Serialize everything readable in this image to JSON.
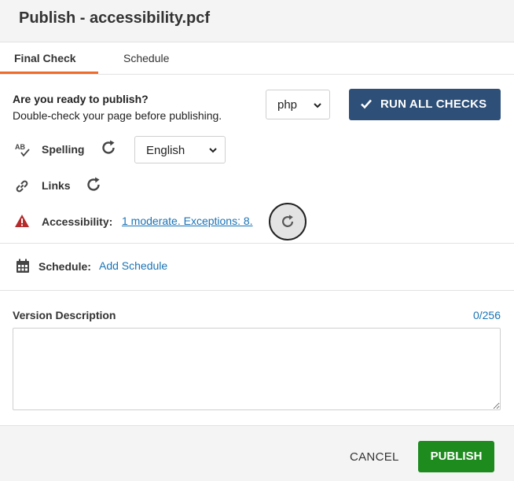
{
  "header": {
    "title": "Publish - accessibility.pcf"
  },
  "tabs": [
    {
      "label": "Final Check",
      "active": true
    },
    {
      "label": "Schedule",
      "active": false
    }
  ],
  "final_check": {
    "question": "Are you ready to publish?",
    "subtext": "Double-check your page before publishing.",
    "output_select": {
      "value": "php"
    },
    "run_button": {
      "label": "RUN ALL CHECKS",
      "icon": "check-icon"
    }
  },
  "checks": {
    "spelling": {
      "label": "Spelling",
      "icon": "spellcheck-icon",
      "language": "English"
    },
    "links": {
      "label": "Links",
      "icon": "link-icon"
    },
    "accessibility": {
      "label": "Accessibility:",
      "icon": "warning-icon",
      "result": "1 moderate. Exceptions: 8.",
      "status_color": "#b52a2a"
    }
  },
  "schedule": {
    "label": "Schedule:",
    "link": "Add Schedule",
    "icon": "calendar-icon"
  },
  "version": {
    "label": "Version Description",
    "count": "0/256",
    "value": ""
  },
  "footer": {
    "cancel": "CANCEL",
    "publish": "PUBLISH"
  },
  "colors": {
    "accent": "#f06a2a",
    "primary": "#2d4f78",
    "link": "#1a73b5",
    "success": "#1e8b1e"
  }
}
